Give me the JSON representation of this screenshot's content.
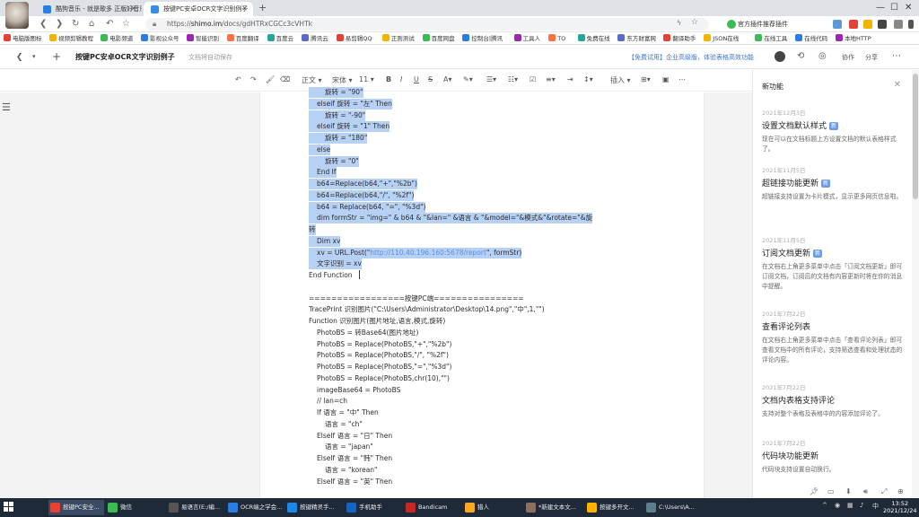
{
  "browser": {
    "tabs": [
      {
        "label": "酷狗音乐 - 就是歌多 正版好音乐",
        "active": false
      },
      {
        "label": "按键PC安卓OCR文字识别例子",
        "active": true
      }
    ],
    "url_prefix": "https://",
    "url_host": "shimo.im",
    "url_path": "/docs/gdHTRxCGCc3cVHTk",
    "ext_text": "官方插件推荐插件",
    "bookmarks": [
      "电脑版图标",
      "视频剪辑教程",
      "电影频道",
      "影视公众号",
      "智能识别",
      "百度翻译",
      "百度云",
      "腾讯云",
      "易剪辑QQ",
      "正则测试",
      "百度网盘",
      "控制台|腾讯",
      "工具人",
      "TO",
      "免费在线",
      "东方财富网",
      "翻译助手",
      "JSON在线",
      "在线工具",
      "在线代码",
      "本地HTTP"
    ]
  },
  "doc": {
    "title": "按键PC安卓OCR文字识别例子",
    "subtitle": "文档将自动保存",
    "promo": "【免费试用】企业高级版，体验表格高效功能",
    "collab": "协作",
    "share": "分享"
  },
  "toolbar": {
    "style": "正文",
    "font": "宋体",
    "size": "11",
    "insert": "插入"
  },
  "code_lines": [
    {
      "text": "旋转 = \"90\"",
      "indent": 2,
      "sel": true
    },
    {
      "text": "elseif 旋转 = \"左\" Then",
      "indent": 1,
      "sel": true
    },
    {
      "text": "旋转 = \"-90\"",
      "indent": 2,
      "sel": true
    },
    {
      "text": "elseif 旋转 = \"1\" Then",
      "indent": 1,
      "sel": true
    },
    {
      "text": "旋转 = \"180\"",
      "indent": 2,
      "sel": true
    },
    {
      "text": "else",
      "indent": 1,
      "sel": true
    },
    {
      "text": "旋转 = \"0\"",
      "indent": 2,
      "sel": true
    },
    {
      "text": "End If",
      "indent": 1,
      "sel": true
    },
    {
      "text": "b64=Replace(b64,\"+\",\"%2b\")",
      "indent": 1,
      "sel": true
    },
    {
      "text": "b64=Replace(b64,\"/\", \"%2f\")",
      "indent": 1,
      "sel": true
    },
    {
      "text": "b64 = Replace(b64, \"=\", \"%3d\")",
      "indent": 1,
      "sel": true
    },
    {
      "text": "dim formStr = \"img=\" & b64 & \"&lan=\" &语言 & \"&model=\"&模式&\"&rotate=\"&旋",
      "indent": 1,
      "sel": true
    },
    {
      "text": "转",
      "indent": 0,
      "sel": true
    },
    {
      "text": "Dim xv",
      "indent": 1,
      "sel": true
    },
    {
      "text": "xv = URL.Post(\"http://110.40.196.160:5678/report\", formStr)",
      "indent": 1,
      "sel": true,
      "link": "http://110.40.196.160:5678/report"
    },
    {
      "text": "文字识别 = xv",
      "indent": 1,
      "sel": true
    },
    {
      "text": "End Function",
      "indent": 0,
      "sel": false
    },
    {
      "text": "",
      "indent": 0,
      "sel": false
    },
    {
      "text": "=================按键PC端================",
      "indent": 0,
      "sel": false
    },
    {
      "text": "TracePrint 识别图片(\"C:\\Users\\Administrator\\Desktop\\14.png\",\"中\",1,\"\")",
      "indent": 0,
      "sel": false
    },
    {
      "text": "Function 识别图片(图片地址,语言,模式,旋转)",
      "indent": 0,
      "sel": false
    },
    {
      "text": "PhotoBS = 转Base64(图片地址)",
      "indent": 1,
      "sel": false
    },
    {
      "text": "PhotoBS = Replace(PhotoBS,\"+\",\"%2b\")",
      "indent": 1,
      "sel": false
    },
    {
      "text": "PhotoBS = Replace(PhotoBS,\"/\", \"%2f\")",
      "indent": 1,
      "sel": false
    },
    {
      "text": "PhotoBS = Replace(PhotoBS,\"=\",\"%3d\")",
      "indent": 1,
      "sel": false
    },
    {
      "text": "PhotoBS = Replace(PhotoBS,chr(10),\"\")",
      "indent": 1,
      "sel": false
    },
    {
      "text": "imageBase64 = PhotoBS",
      "indent": 1,
      "sel": false
    },
    {
      "text": "//    lan=ch",
      "indent": 1,
      "sel": false
    },
    {
      "text": "If 语言 = \"中\" Then",
      "indent": 1,
      "sel": false
    },
    {
      "text": "语言 = \"ch\"",
      "indent": 2,
      "sel": false
    },
    {
      "text": "ElseIf 语言 = \"日\" Then",
      "indent": 1,
      "sel": false
    },
    {
      "text": "语言 = \"japan\"",
      "indent": 2,
      "sel": false
    },
    {
      "text": "ElseIf 语言 = \"韩\" Then",
      "indent": 1,
      "sel": false
    },
    {
      "text": "语言 = \"korean\"",
      "indent": 2,
      "sel": false
    },
    {
      "text": "ElseIf 语言 = \"英\" Then",
      "indent": 1,
      "sel": false
    }
  ],
  "panel": {
    "title": "新功能",
    "items": [
      {
        "date": "2021年12月3日",
        "heading": "设置文档默认样式",
        "badge": "新",
        "body": "现在可以在文档标题上方设置文档的默认表格样式了。"
      },
      {
        "date": "2021年11月5日",
        "heading": "超链接功能更新",
        "badge": "新",
        "body": "超链接支持设置为卡片模式，显示更多网页信息啦。"
      },
      {
        "date": "2021年11月5日",
        "heading": "订阅文档更新",
        "badge": "新",
        "body": "在文档右上角更多菜单中点击「订阅文档更新」即可订阅文档，订阅后的文档有内容更新时将在你的消息中提醒。"
      },
      {
        "date": "2021年7月22日",
        "heading": "查看评论列表",
        "badge": "",
        "body": "在文档右上角更多菜单中点击「查看评论列表」即可查看文档中的所有评论，支持筛选查看和处理状态的评论内容。"
      },
      {
        "date": "2021年7月22日",
        "heading": "文档内表格支持评论",
        "badge": "",
        "body": "支持对整个表格及表格中的内容添加评论了。"
      },
      {
        "date": "2021年7月22日",
        "heading": "代码块功能更新",
        "badge": "",
        "body": "代码块支持设置自动换行。"
      }
    ]
  },
  "taskbar": {
    "items": [
      "按键PC安全...",
      "微信",
      "易语言(E:/编...",
      "OCR端之学会...",
      "按键精灵手...",
      "手机助手",
      "Bandicam",
      "猎人",
      "*新建文本文...",
      "按键多开文...",
      "C:\\Users\\A..."
    ],
    "time": "13:52",
    "date": "2021/12/24"
  },
  "colors": {
    "accent": "#3f72c8",
    "selection": "#b7d1f5",
    "badge": "#6b9be8"
  }
}
